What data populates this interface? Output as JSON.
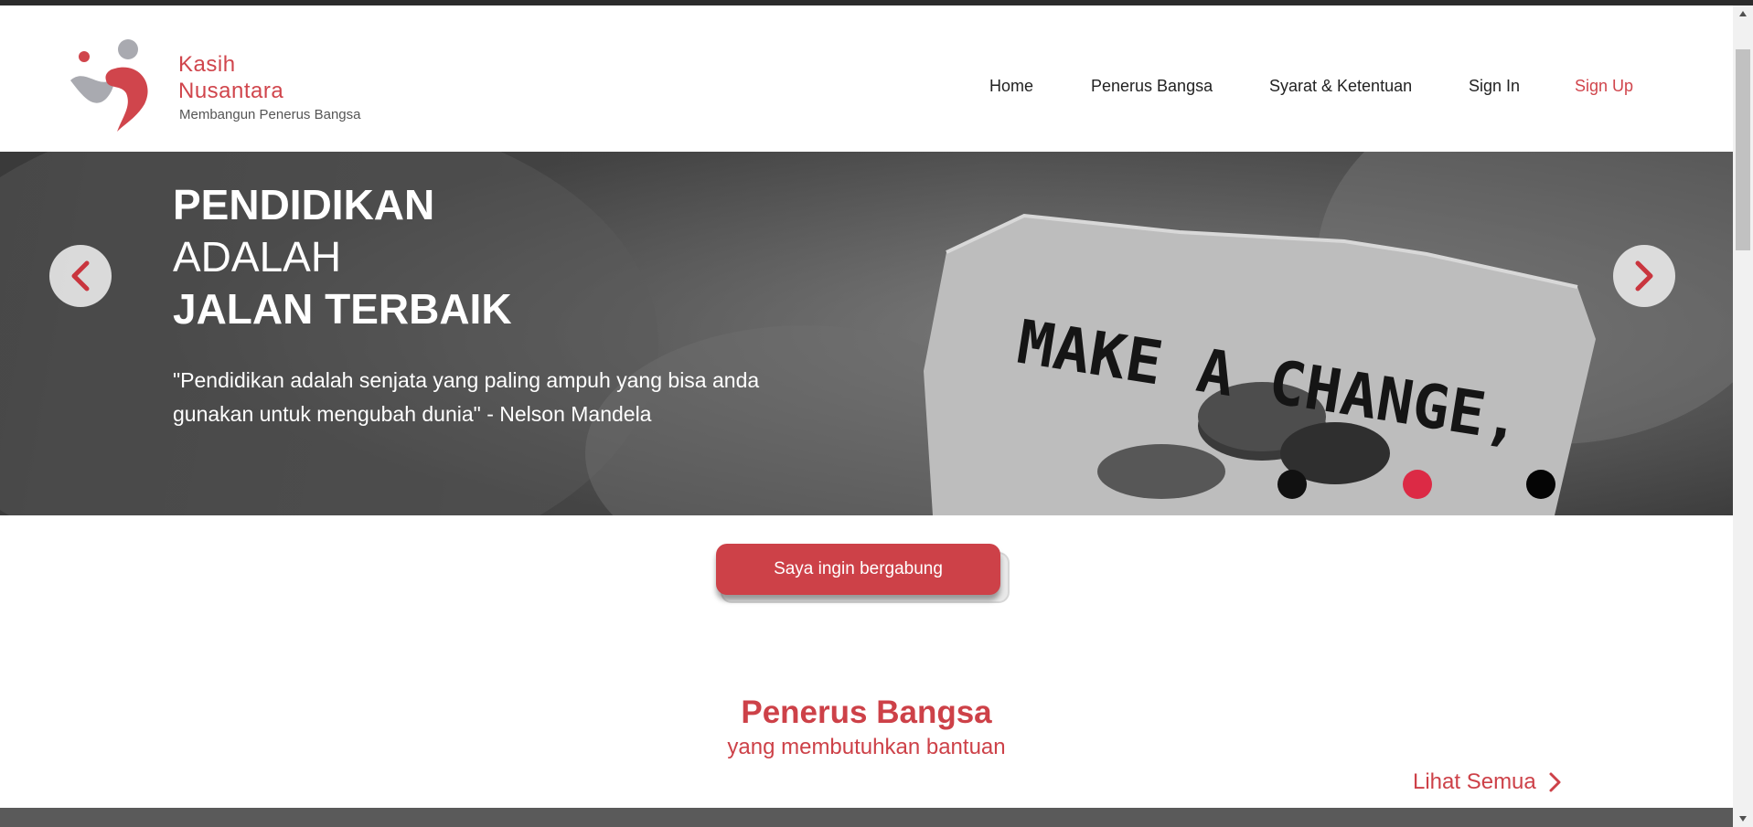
{
  "brand": {
    "name_line1": "Kasih",
    "name_line2": "Nusantara",
    "tagline": "Membangun Penerus Bangsa"
  },
  "nav": {
    "items": [
      {
        "label": "Home"
      },
      {
        "label": "Penerus Bangsa"
      },
      {
        "label": "Syarat & Ketentuan"
      },
      {
        "label": "Sign In"
      },
      {
        "label": "Sign Up"
      }
    ]
  },
  "hero": {
    "title_line1": "PENDIDIKAN",
    "title_line2": "ADALAH",
    "title_line3": "JALAN TERBAIK",
    "quote_line1": "\"Pendidikan adalah senjata yang paling ampuh yang bisa anda",
    "quote_line2": "gunakan untuk mengubah dunia\" - Nelson Mandela",
    "image_text": "MAKE A CHANGE,",
    "active_slide": 2,
    "slide_count": 3
  },
  "cta": {
    "join_label": "Saya ingin bergabung"
  },
  "section": {
    "title": "Penerus Bangsa",
    "subtitle": "yang membutuhkan bantuan",
    "see_all": "Lihat Semua"
  },
  "colors": {
    "accent": "#cd4148",
    "active_dot": "#dc2a45",
    "dark": "#222222"
  },
  "icons": {
    "prev": "chevron-left-icon",
    "next": "chevron-right-icon",
    "see_all": "chevron-right-icon"
  }
}
